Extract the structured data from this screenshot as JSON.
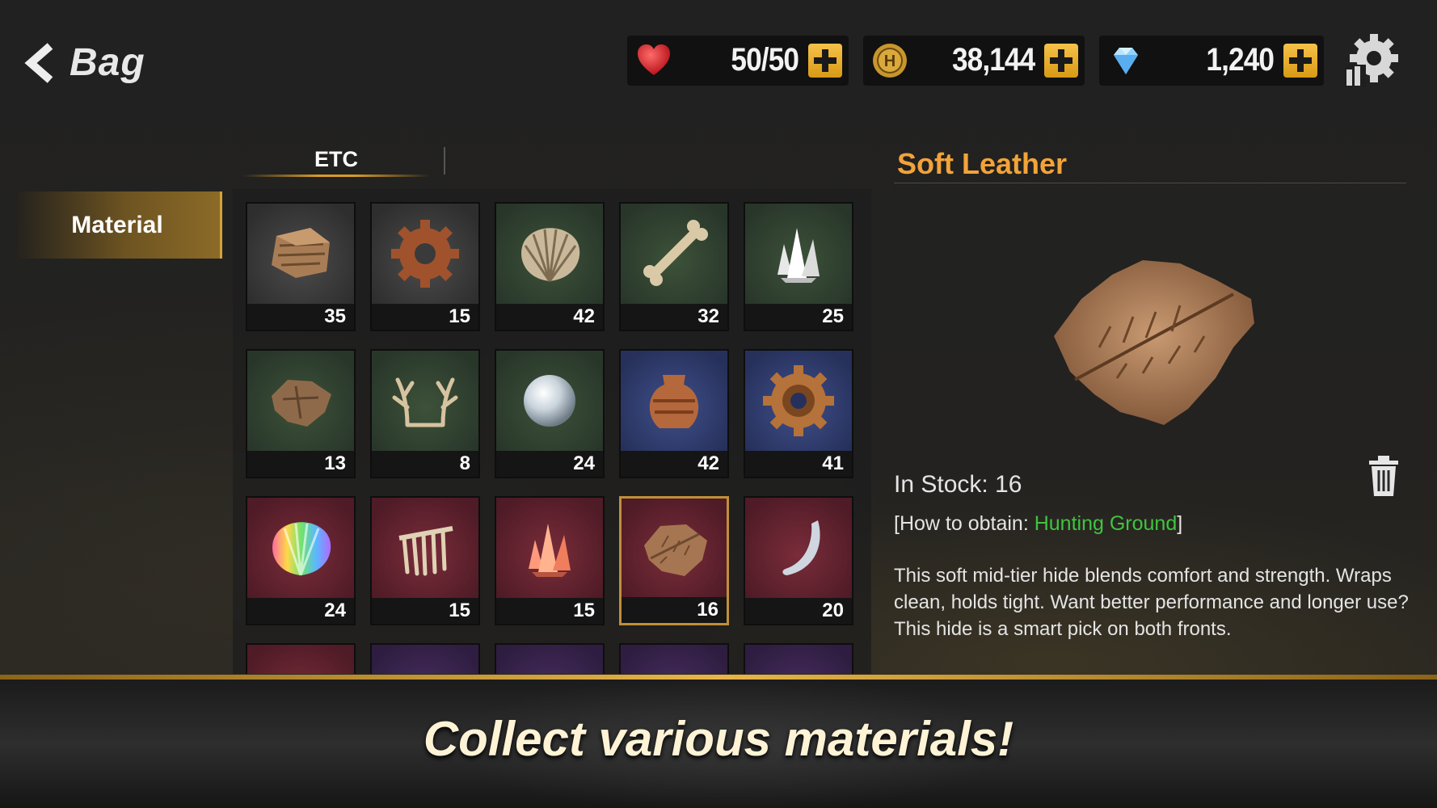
{
  "header": {
    "title": "Bag",
    "resources": [
      {
        "name": "stamina",
        "icon": "heart-icon",
        "value": "50/50"
      },
      {
        "name": "gold",
        "icon": "gold-coin-icon",
        "value": "38,144"
      },
      {
        "name": "gems",
        "icon": "diamond-icon",
        "value": "1,240"
      }
    ]
  },
  "tabs": {
    "etc": "ETC"
  },
  "sidebar": {
    "material": "Material"
  },
  "items": [
    {
      "name": "ancient-shard",
      "count": "35",
      "rarity": "gray"
    },
    {
      "name": "rusty-gear",
      "count": "15",
      "rarity": "gray"
    },
    {
      "name": "shell",
      "count": "42",
      "rarity": "green"
    },
    {
      "name": "bone",
      "count": "32",
      "rarity": "green"
    },
    {
      "name": "white-crystal",
      "count": "25",
      "rarity": "green"
    },
    {
      "name": "rough-hide",
      "count": "13",
      "rarity": "green"
    },
    {
      "name": "antler",
      "count": "8",
      "rarity": "green"
    },
    {
      "name": "pearl",
      "count": "24",
      "rarity": "green"
    },
    {
      "name": "ancient-vase",
      "count": "42",
      "rarity": "blue"
    },
    {
      "name": "bronze-gear",
      "count": "41",
      "rarity": "blue"
    },
    {
      "name": "rainbow-shell",
      "count": "24",
      "rarity": "red"
    },
    {
      "name": "rib-bones",
      "count": "15",
      "rarity": "red"
    },
    {
      "name": "red-crystal",
      "count": "15",
      "rarity": "red"
    },
    {
      "name": "soft-leather",
      "count": "16",
      "rarity": "red"
    },
    {
      "name": "fang",
      "count": "20",
      "rarity": "red"
    }
  ],
  "detail": {
    "title": "Soft Leather",
    "stock_label": "In Stock: 16",
    "obtain_prefix": "[How to obtain: ",
    "obtain_location": "Hunting Ground",
    "obtain_suffix": "]",
    "description": "This soft mid-tier hide blends comfort and strength. Wraps clean, holds tight. Want better performance and longer use? This hide is a smart pick on both fronts."
  },
  "banner": {
    "text": "Collect various materials!"
  },
  "colors": {
    "accent": "#f2a339",
    "location": "#3fc43f",
    "gold_button": "#e8ad2f"
  }
}
